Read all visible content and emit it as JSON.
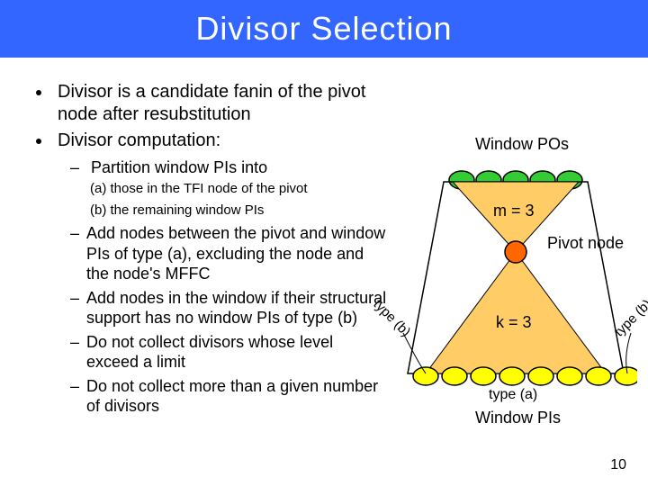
{
  "title": "Divisor Selection",
  "bullets": {
    "b1": "Divisor is a candidate fanin of the pivot node after resubstitution",
    "b2": "Divisor computation:",
    "s1": "Partition window PIs into",
    "ss_a": "(a) those in the TFI node of the pivot",
    "ss_b": "(b) the remaining window PIs",
    "s2": "Add nodes between the pivot and window PIs of type (a), excluding the node and the node's MFFC",
    "s3": "Add nodes in the window if their structural support has no window PIs of type (b)",
    "s4": "Do not collect divisors whose level exceed a limit",
    "s5": "Do not collect more than a given number of divisors"
  },
  "figure": {
    "window_pos": "Window POs",
    "m_label": "m = 3",
    "pivot_label": "Pivot node",
    "k_label": "k = 3",
    "type_b_left": "type (b)",
    "type_b_right": "type (b)",
    "type_a": "type (a)",
    "window_pis": "Window PIs"
  },
  "page_number": "10"
}
